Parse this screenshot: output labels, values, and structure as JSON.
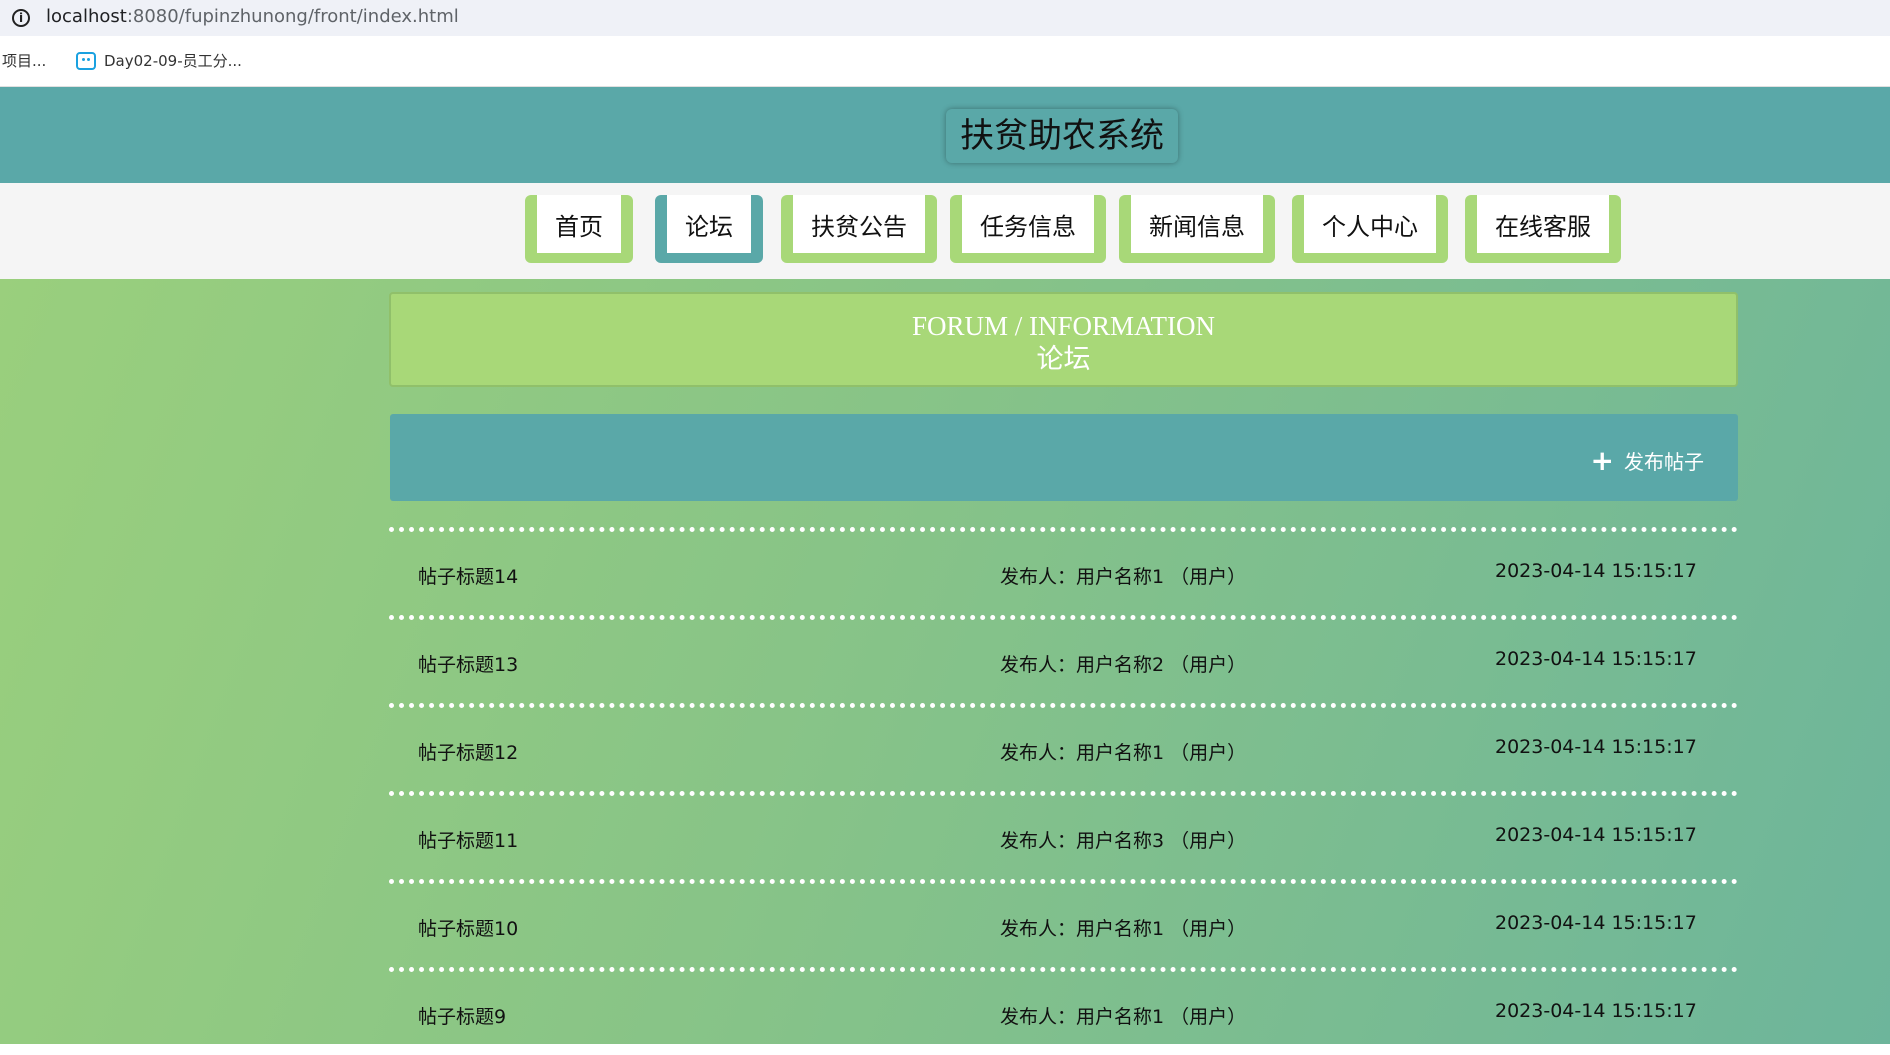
{
  "browser": {
    "url_host": "localhost",
    "url_path": ":8080/fupinzhunong/front/index.html",
    "bookmarks": [
      {
        "label": "项目..."
      },
      {
        "label": "Day02-09-员工分..."
      }
    ]
  },
  "header": {
    "site_title": "扶贫助农系统"
  },
  "nav": {
    "items": [
      {
        "label": "首页"
      },
      {
        "label": "论坛"
      },
      {
        "label": "扶贫公告"
      },
      {
        "label": "任务信息"
      },
      {
        "label": "新闻信息"
      },
      {
        "label": "个人中心"
      },
      {
        "label": "在线客服"
      }
    ],
    "active": "论坛"
  },
  "banner": {
    "en": "FORUM / INFORMATION",
    "cn": "论坛"
  },
  "toolbar": {
    "publish_label": "发布帖子",
    "publish_icon": "plus-icon"
  },
  "posts": [
    {
      "title": "帖子标题14",
      "author": "发布人：用户名称1 （用户）",
      "time": "2023-04-14 15:15:17"
    },
    {
      "title": "帖子标题13",
      "author": "发布人：用户名称2 （用户）",
      "time": "2023-04-14 15:15:17"
    },
    {
      "title": "帖子标题12",
      "author": "发布人：用户名称1 （用户）",
      "time": "2023-04-14 15:15:17"
    },
    {
      "title": "帖子标题11",
      "author": "发布人：用户名称3 （用户）",
      "time": "2023-04-14 15:15:17"
    },
    {
      "title": "帖子标题10",
      "author": "发布人：用户名称1 （用户）",
      "time": "2023-04-14 15:15:17"
    },
    {
      "title": "帖子标题9",
      "author": "发布人：用户名称1 （用户）",
      "time": "2023-04-14 15:15:17"
    }
  ],
  "colors": {
    "header_teal": "#5aa8a8",
    "accent_green": "#a8d878"
  }
}
